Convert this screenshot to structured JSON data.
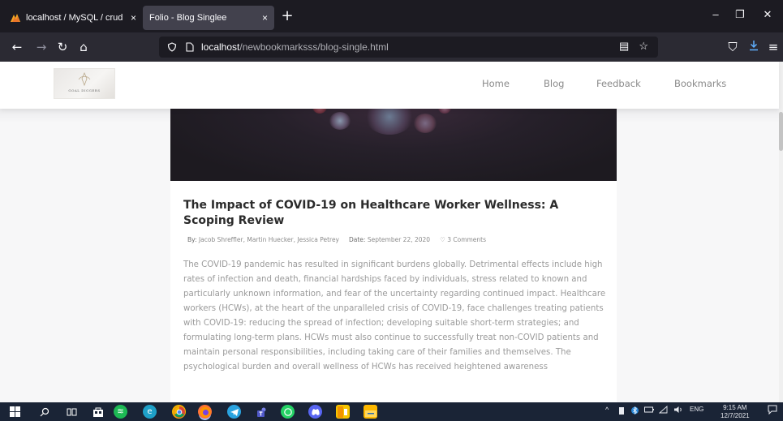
{
  "browser": {
    "tabs": [
      {
        "title": "localhost / MySQL / crud | php",
        "active": false
      },
      {
        "title": "Folio - Blog Singlee",
        "active": true
      }
    ],
    "new_tab": "+",
    "url_host": "localhost",
    "url_path": "/newbookmarksss/blog-single.html"
  },
  "site": {
    "logo_text": "GOAL DIGGERS",
    "nav": [
      "Home",
      "Blog",
      "Feedback",
      "Bookmarks"
    ]
  },
  "article": {
    "title": "The Impact of COVID-19 on Healthcare Worker Wellness: A Scoping Review",
    "authors_label": "By:",
    "authors": "Jacob Shreffler, Martin Huecker, Jessica Petrey",
    "date_label": "Date:",
    "date": "September 22, 2020",
    "comments": "3 Comments",
    "body": "The COVID-19 pandemic has resulted in significant burdens globally. Detrimental effects include high rates of infection and death, financial hardships faced by individuals, stress related to known and particularly unknown information, and fear of the uncertainty regarding continued impact. Healthcare workers (HCWs), at the heart of the unparalleled crisis of COVID-19, face challenges treating patients with COVID-19: reducing the spread of infection; developing suitable short-term strategies; and formulating long-term plans. HCWs must also continue to successfully treat non-COVID patients and maintain personal responsibilities, including taking care of their families and themselves. The psychological burden and overall wellness of HCWs has received heightened awareness"
  },
  "taskbar": {
    "language": "ENG",
    "time": "9:15 AM",
    "date": "12/7/2021"
  },
  "colors": {
    "tabbar": "#1c1b22",
    "navbar": "#2b2a33",
    "taskbar": "#1a2436",
    "title_text": "#2b2b2b",
    "body_text": "#9a9a9a"
  }
}
